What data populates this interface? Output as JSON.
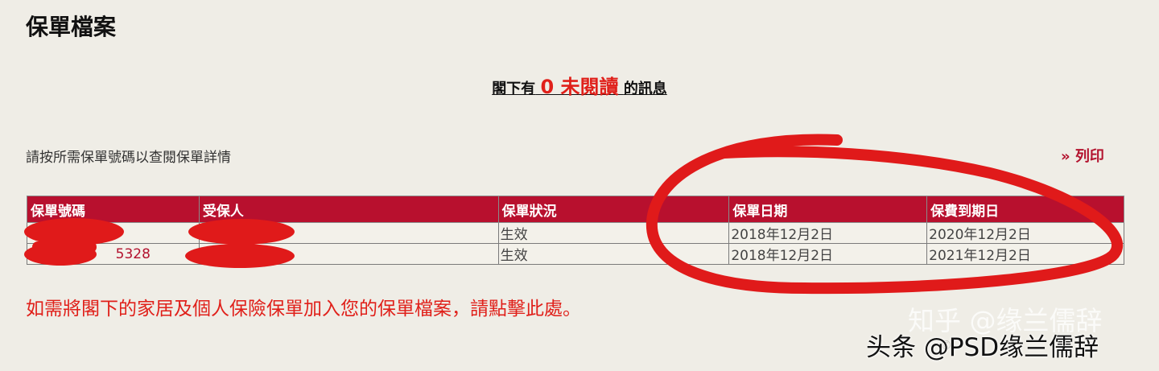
{
  "page": {
    "title": "保單檔案"
  },
  "notice": {
    "prefix": "閣下有",
    "count": "0 未閱讀",
    "suffix": "的訊息"
  },
  "instruction": "請按所需保單號碼以查閱保單詳情",
  "print_link": "» 列印",
  "table": {
    "headers": [
      "保單號碼",
      "受保人",
      "保單狀況",
      "保單日期",
      "保費到期日"
    ],
    "rows": [
      {
        "policy_no": "",
        "insured": "",
        "status": "生效",
        "policy_date": "2018年12月2日",
        "due_date": "2020年12月2日"
      },
      {
        "policy_no": "5328",
        "insured": "",
        "status": "生效",
        "policy_date": "2018年12月2日",
        "due_date": "2021年12月2日"
      }
    ]
  },
  "add_note": "如需將閣下的家居及個人保險保單加入您的保單檔案，請點擊此處。",
  "watermarks": {
    "zhihu": "知乎 @缘兰儒辞",
    "toutiao": "头条 @PSD缘兰儒辞"
  },
  "colors": {
    "brand_red": "#b8102e",
    "alert_red": "#e0201a",
    "background": "#efede6"
  }
}
